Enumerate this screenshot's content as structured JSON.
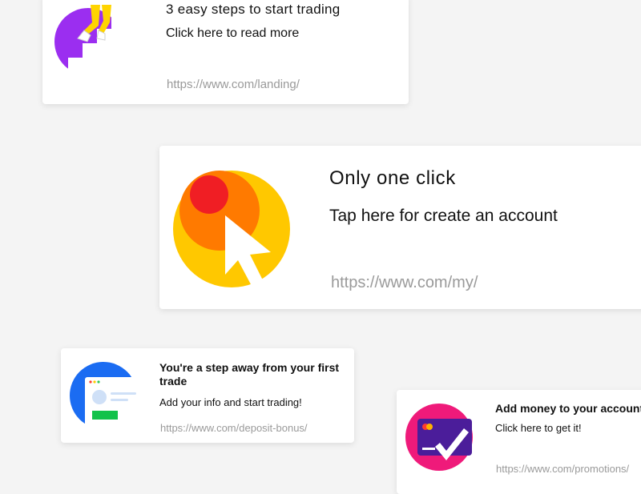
{
  "cards": [
    {
      "title": "3 easy steps to start trading",
      "subtitle": "Click here to read more",
      "url": "https://www.com/landing/",
      "icon": "stairs-climbing-icon",
      "accent": "#9b2ef0"
    },
    {
      "title": "Only one click",
      "subtitle": "Tap here for create an account",
      "url": "https://www.com/my/",
      "icon": "cursor-click-icon",
      "accent": "#ffc800"
    },
    {
      "title": "You're a step away from your first trade",
      "subtitle": "Add your info and start trading!",
      "url": "https://www.com/deposit-bonus/",
      "icon": "profile-form-icon",
      "accent": "#1b6cf2"
    },
    {
      "title": "Add money to your account",
      "subtitle": "Click here to get it!",
      "url": "https://www.com/promotions/",
      "icon": "credit-card-check-icon",
      "accent": "#ef1a7a"
    }
  ]
}
